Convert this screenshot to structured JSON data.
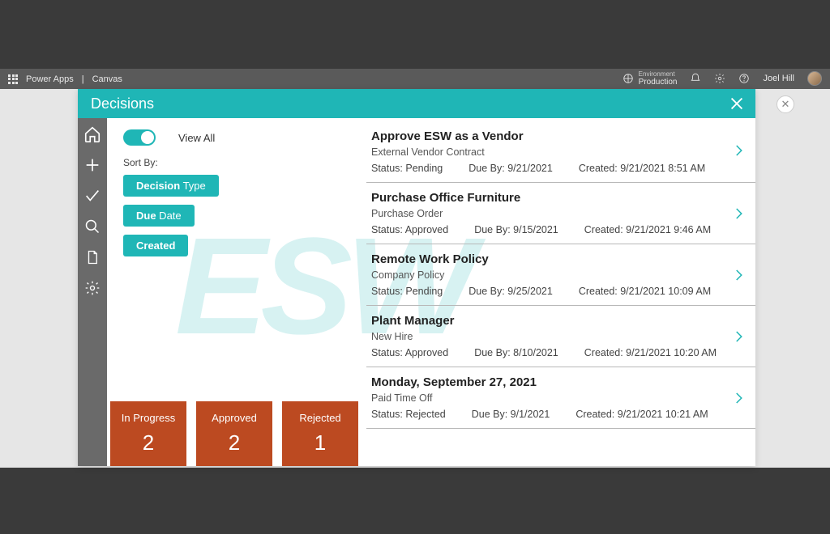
{
  "powerapps": {
    "brand": "Power Apps",
    "separator": "|",
    "page": "Canvas",
    "env_label": "Environment",
    "env_name": "Production",
    "user": "Joel Hill"
  },
  "app": {
    "title": "Decisions",
    "watermark": "ESW"
  },
  "toggle": {
    "label": "View All"
  },
  "sort": {
    "label": "Sort By:",
    "buttons": [
      {
        "bold": "Decision",
        "rest": " Type"
      },
      {
        "bold": "Due",
        "rest": " Date"
      },
      {
        "bold": "Created",
        "rest": ""
      }
    ]
  },
  "stats": [
    {
      "label": "In Progress",
      "value": "2"
    },
    {
      "label": "Approved",
      "value": "2"
    },
    {
      "label": "Rejected",
      "value": "1"
    }
  ],
  "items": [
    {
      "title": "Approve ESW as a Vendor",
      "subtitle": "External Vendor Contract",
      "status": "Status: Pending",
      "due": "Due By: 9/21/2021",
      "created": "Created: 9/21/2021 8:51 AM"
    },
    {
      "title": "Purchase Office Furniture",
      "subtitle": "Purchase Order",
      "status": "Status: Approved",
      "due": "Due By: 9/15/2021",
      "created": "Created: 9/21/2021 9:46 AM"
    },
    {
      "title": "Remote Work Policy",
      "subtitle": "Company Policy",
      "status": "Status: Pending",
      "due": "Due By: 9/25/2021",
      "created": "Created: 9/21/2021 10:09 AM"
    },
    {
      "title": "Plant Manager",
      "subtitle": "New Hire",
      "status": "Status: Approved",
      "due": "Due By: 8/10/2021",
      "created": "Created: 9/21/2021 10:20 AM"
    },
    {
      "title": "Monday, September 27, 2021",
      "subtitle": "Paid Time Off",
      "status": "Status: Rejected",
      "due": "Due By: 9/1/2021",
      "created": "Created: 9/21/2021 10:21 AM"
    }
  ]
}
